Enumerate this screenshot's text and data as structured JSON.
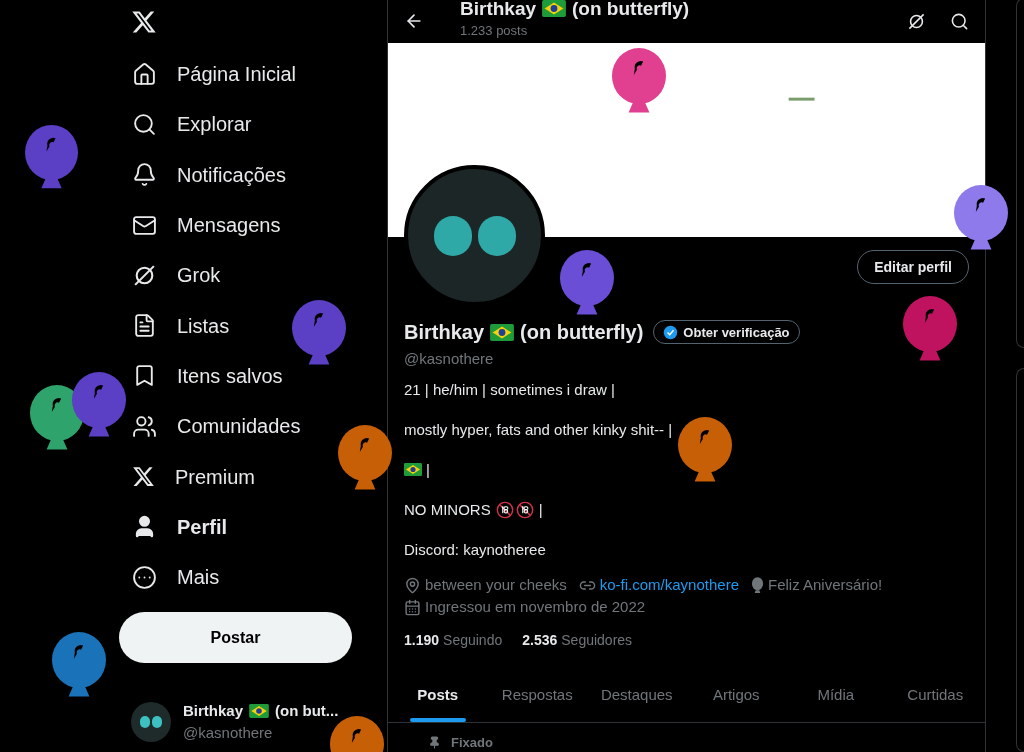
{
  "nav": {
    "items": [
      {
        "label": "Página Inicial",
        "selected": false
      },
      {
        "label": "Explorar",
        "selected": false
      },
      {
        "label": "Notificações",
        "selected": false
      },
      {
        "label": "Mensagens",
        "selected": false
      },
      {
        "label": "Grok",
        "selected": false
      },
      {
        "label": "Listas",
        "selected": false
      },
      {
        "label": "Itens salvos",
        "selected": false
      },
      {
        "label": "Comunidades",
        "selected": false
      },
      {
        "label": "Premium",
        "selected": false
      },
      {
        "label": "Perfil",
        "selected": true
      },
      {
        "label": "Mais",
        "selected": false
      }
    ],
    "post_button": "Postar",
    "account": {
      "name_start": "Birthkay",
      "name_end": "(on but...",
      "handle": "@kasnothere"
    }
  },
  "header": {
    "name_start": "Birthkay",
    "name_end": "(on butterfly)",
    "posts": "1.233 posts"
  },
  "profile": {
    "edit_button": "Editar perfil",
    "name_start": "Birthkay",
    "name_end": "(on butterfly)",
    "verify_button": "Obter verificação",
    "handle": "@kasnothere",
    "bio": [
      {
        "kind": "text",
        "text": "21 | he/him | sometimes i draw |"
      },
      {
        "kind": "text",
        "text": "mostly hyper, fats and other kinky shit-- |"
      },
      {
        "kind": "flag",
        "text": "|"
      },
      {
        "kind": "minors",
        "text": "NO MINORS",
        "end": "|"
      },
      {
        "kind": "text",
        "text": "Discord: kaynotheree"
      }
    ],
    "location": "between your cheeks",
    "link": "ko-fi.com/kaynothere",
    "birthday": "Feliz Aniversário!",
    "joined": "Ingressou em novembro de 2022",
    "following_count": "1.190",
    "following_label": "Seguindo",
    "followers_count": "2.536",
    "followers_label": "Seguidores"
  },
  "tabs": [
    {
      "label": "Posts",
      "selected": true
    },
    {
      "label": "Respostas",
      "selected": false
    },
    {
      "label": "Destaques",
      "selected": false
    },
    {
      "label": "Artigos",
      "selected": false
    },
    {
      "label": "Mídia",
      "selected": false
    },
    {
      "label": "Curtidas",
      "selected": false
    }
  ],
  "pinned_label": "Fixado"
}
